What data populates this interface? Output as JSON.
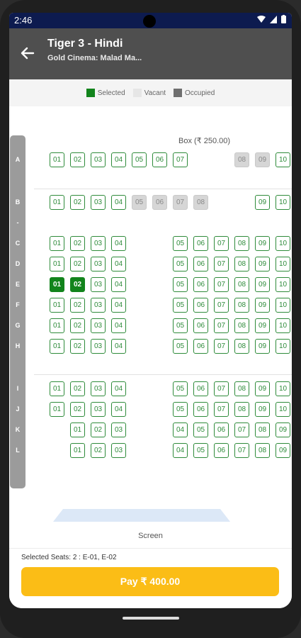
{
  "status_bar": {
    "time": "2:46"
  },
  "app_bar": {
    "title": "Tiger 3 - Hindi",
    "subtitle": "Gold Cinema: Malad Ma..."
  },
  "legend": [
    {
      "label": "Selected",
      "color": "#12841c"
    },
    {
      "label": "Vacant",
      "color": "#e6e6e6"
    },
    {
      "label": "Occupied",
      "color": "#6f6f6f"
    }
  ],
  "seat_map": {
    "section_label": "Box (₹ 250.00)",
    "row_letters": [
      "A",
      "B",
      "-",
      "C",
      "D",
      "E",
      "F",
      "G",
      "H",
      "I",
      "J",
      "K",
      "L"
    ],
    "rows": [
      {
        "letter": "A",
        "seats": [
          {
            "n": "01",
            "s": "v"
          },
          {
            "n": "02",
            "s": "v"
          },
          {
            "n": "03",
            "s": "v"
          },
          {
            "n": "04",
            "s": "v"
          },
          {
            "n": "05",
            "s": "v"
          },
          {
            "n": "06",
            "s": "v"
          },
          {
            "n": "07",
            "s": "v"
          },
          {
            "n": "08",
            "s": "o"
          },
          {
            "n": "09",
            "s": "o"
          },
          {
            "n": "10",
            "s": "v"
          }
        ]
      },
      {
        "letter": "B",
        "seats": [
          {
            "n": "01",
            "s": "v"
          },
          {
            "n": "02",
            "s": "v"
          },
          {
            "n": "03",
            "s": "v"
          },
          {
            "n": "04",
            "s": "v"
          },
          {
            "n": "05",
            "s": "o"
          },
          {
            "n": "06",
            "s": "o"
          },
          {
            "n": "07",
            "s": "o"
          },
          {
            "n": "08",
            "s": "o"
          },
          {
            "n": "09",
            "s": "v"
          },
          {
            "n": "10",
            "s": "v"
          }
        ]
      },
      {
        "letter": "C",
        "seats": [
          {
            "n": "01",
            "s": "v"
          },
          {
            "n": "02",
            "s": "v"
          },
          {
            "n": "03",
            "s": "v"
          },
          {
            "n": "04",
            "s": "v"
          },
          {
            "n": "05",
            "s": "v"
          },
          {
            "n": "06",
            "s": "v"
          },
          {
            "n": "07",
            "s": "v"
          },
          {
            "n": "08",
            "s": "v"
          },
          {
            "n": "09",
            "s": "v"
          },
          {
            "n": "10",
            "s": "v"
          }
        ]
      },
      {
        "letter": "D",
        "seats": [
          {
            "n": "01",
            "s": "v"
          },
          {
            "n": "02",
            "s": "v"
          },
          {
            "n": "03",
            "s": "v"
          },
          {
            "n": "04",
            "s": "v"
          },
          {
            "n": "05",
            "s": "v"
          },
          {
            "n": "06",
            "s": "v"
          },
          {
            "n": "07",
            "s": "v"
          },
          {
            "n": "08",
            "s": "v"
          },
          {
            "n": "09",
            "s": "v"
          },
          {
            "n": "10",
            "s": "v"
          }
        ]
      },
      {
        "letter": "E",
        "seats": [
          {
            "n": "01",
            "s": "s"
          },
          {
            "n": "02",
            "s": "s"
          },
          {
            "n": "03",
            "s": "v"
          },
          {
            "n": "04",
            "s": "v"
          },
          {
            "n": "05",
            "s": "v"
          },
          {
            "n": "06",
            "s": "v"
          },
          {
            "n": "07",
            "s": "v"
          },
          {
            "n": "08",
            "s": "v"
          },
          {
            "n": "09",
            "s": "v"
          },
          {
            "n": "10",
            "s": "v"
          }
        ]
      },
      {
        "letter": "F",
        "seats": [
          {
            "n": "01",
            "s": "v"
          },
          {
            "n": "02",
            "s": "v"
          },
          {
            "n": "03",
            "s": "v"
          },
          {
            "n": "04",
            "s": "v"
          },
          {
            "n": "05",
            "s": "v"
          },
          {
            "n": "06",
            "s": "v"
          },
          {
            "n": "07",
            "s": "v"
          },
          {
            "n": "08",
            "s": "v"
          },
          {
            "n": "09",
            "s": "v"
          },
          {
            "n": "10",
            "s": "v"
          }
        ]
      },
      {
        "letter": "G",
        "seats": [
          {
            "n": "01",
            "s": "v"
          },
          {
            "n": "02",
            "s": "v"
          },
          {
            "n": "03",
            "s": "v"
          },
          {
            "n": "04",
            "s": "v"
          },
          {
            "n": "05",
            "s": "v"
          },
          {
            "n": "06",
            "s": "v"
          },
          {
            "n": "07",
            "s": "v"
          },
          {
            "n": "08",
            "s": "v"
          },
          {
            "n": "09",
            "s": "v"
          },
          {
            "n": "10",
            "s": "v"
          }
        ]
      },
      {
        "letter": "H",
        "seats": [
          {
            "n": "01",
            "s": "v"
          },
          {
            "n": "02",
            "s": "v"
          },
          {
            "n": "03",
            "s": "v"
          },
          {
            "n": "04",
            "s": "v"
          },
          {
            "n": "05",
            "s": "v"
          },
          {
            "n": "06",
            "s": "v"
          },
          {
            "n": "07",
            "s": "v"
          },
          {
            "n": "08",
            "s": "v"
          },
          {
            "n": "09",
            "s": "v"
          },
          {
            "n": "10",
            "s": "v"
          }
        ]
      },
      {
        "letter": "I",
        "seats": [
          {
            "n": "01",
            "s": "v"
          },
          {
            "n": "02",
            "s": "v"
          },
          {
            "n": "03",
            "s": "v"
          },
          {
            "n": "04",
            "s": "v"
          },
          {
            "n": "05",
            "s": "v"
          },
          {
            "n": "06",
            "s": "v"
          },
          {
            "n": "07",
            "s": "v"
          },
          {
            "n": "08",
            "s": "v"
          },
          {
            "n": "09",
            "s": "v"
          },
          {
            "n": "10",
            "s": "v"
          }
        ]
      },
      {
        "letter": "J",
        "seats": [
          {
            "n": "01",
            "s": "v"
          },
          {
            "n": "02",
            "s": "v"
          },
          {
            "n": "03",
            "s": "v"
          },
          {
            "n": "04",
            "s": "v"
          },
          {
            "n": "05",
            "s": "v"
          },
          {
            "n": "06",
            "s": "v"
          },
          {
            "n": "07",
            "s": "v"
          },
          {
            "n": "08",
            "s": "v"
          },
          {
            "n": "09",
            "s": "v"
          },
          {
            "n": "10",
            "s": "v"
          }
        ]
      },
      {
        "letter": "K",
        "seats": [
          {
            "n": "01",
            "s": "v"
          },
          {
            "n": "02",
            "s": "v"
          },
          {
            "n": "03",
            "s": "v"
          },
          {
            "n": "04",
            "s": "v"
          },
          {
            "n": "05",
            "s": "v"
          },
          {
            "n": "06",
            "s": "v"
          },
          {
            "n": "07",
            "s": "v"
          },
          {
            "n": "08",
            "s": "v"
          },
          {
            "n": "09",
            "s": "v"
          }
        ]
      },
      {
        "letter": "L",
        "seats": [
          {
            "n": "01",
            "s": "v"
          },
          {
            "n": "02",
            "s": "v"
          },
          {
            "n": "03",
            "s": "v"
          },
          {
            "n": "04",
            "s": "v"
          },
          {
            "n": "05",
            "s": "v"
          },
          {
            "n": "06",
            "s": "v"
          },
          {
            "n": "07",
            "s": "v"
          },
          {
            "n": "08",
            "s": "v"
          },
          {
            "n": "09",
            "s": "v"
          }
        ]
      }
    ]
  },
  "screen_label": "Screen",
  "footer": {
    "selected_text": "Selected Seats: 2 : E-01, E-02",
    "pay_label": "Pay ₹ 400.00"
  }
}
